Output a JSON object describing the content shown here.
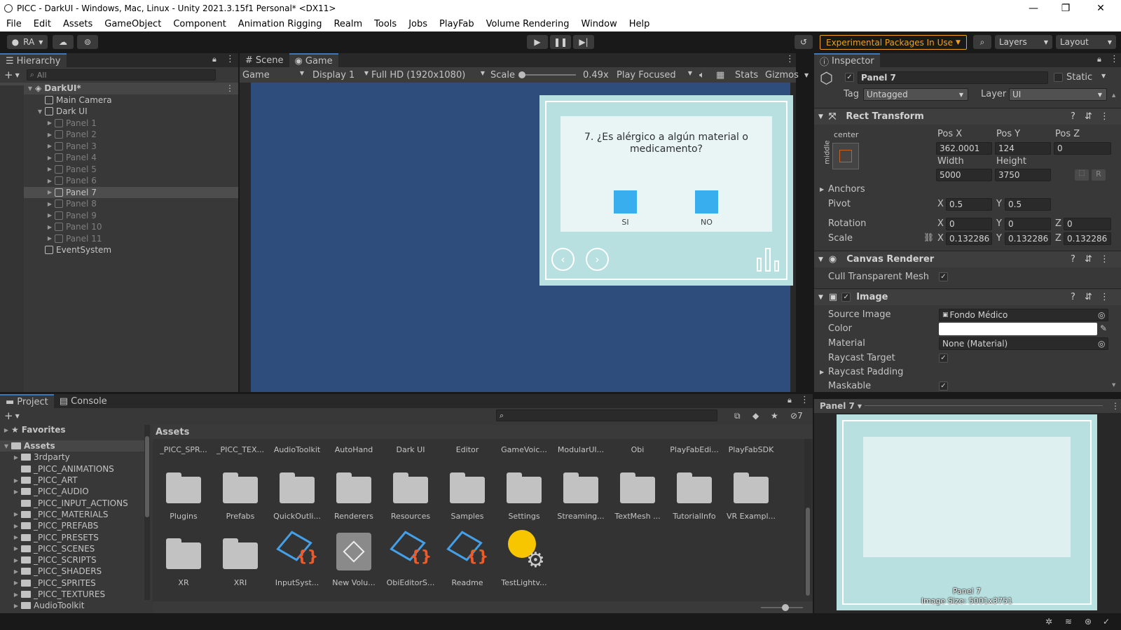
{
  "window": {
    "title": "PICC - DarkUI - Windows, Mac, Linux - Unity 2021.3.15f1 Personal* <DX11>",
    "minimize": "—",
    "maximize": "❐",
    "close": "✕"
  },
  "menu": [
    "File",
    "Edit",
    "Assets",
    "GameObject",
    "Component",
    "Animation Rigging",
    "Realm",
    "Tools",
    "Jobs",
    "PlayFab",
    "Volume Rendering",
    "Window",
    "Help"
  ],
  "toolbar": {
    "account": "RA",
    "experimental": "Experimental Packages In Use",
    "layers": "Layers",
    "layout": "Layout"
  },
  "hierarchy": {
    "tab": "Hierarchy",
    "search_placeholder": "All",
    "scene": "DarkUI*",
    "items": [
      {
        "label": "Main Camera",
        "dim": false,
        "indent": 1,
        "arrow": ""
      },
      {
        "label": "Dark UI",
        "dim": false,
        "indent": 1,
        "arrow": "▼"
      },
      {
        "label": "Panel 1",
        "dim": true,
        "indent": 2,
        "arrow": "▶"
      },
      {
        "label": "Panel 2",
        "dim": true,
        "indent": 2,
        "arrow": "▶"
      },
      {
        "label": "Panel 3",
        "dim": true,
        "indent": 2,
        "arrow": "▶"
      },
      {
        "label": "Panel 4",
        "dim": true,
        "indent": 2,
        "arrow": "▶"
      },
      {
        "label": "Panel 5",
        "dim": true,
        "indent": 2,
        "arrow": "▶"
      },
      {
        "label": "Panel 6",
        "dim": true,
        "indent": 2,
        "arrow": "▶"
      },
      {
        "label": "Panel 7",
        "dim": false,
        "indent": 2,
        "arrow": "▶",
        "selected": true
      },
      {
        "label": "Panel 8",
        "dim": true,
        "indent": 2,
        "arrow": "▶"
      },
      {
        "label": "Panel 9",
        "dim": true,
        "indent": 2,
        "arrow": "▶"
      },
      {
        "label": "Panel 10",
        "dim": true,
        "indent": 2,
        "arrow": "▶"
      },
      {
        "label": "Panel 11",
        "dim": true,
        "indent": 2,
        "arrow": "▶"
      },
      {
        "label": "EventSystem",
        "dim": false,
        "indent": 1,
        "arrow": ""
      }
    ]
  },
  "game": {
    "tabs": [
      "Scene",
      "Game"
    ],
    "display_mode": "Game",
    "display": "Display 1",
    "resolution": "Full HD (1920x1080)",
    "scale_label": "Scale",
    "scale_value": "0.49x",
    "play_mode": "Play Focused",
    "stats": "Stats",
    "gizmos": "Gizmos",
    "question": "7. ¿Es alérgico a algún material o medicamento?",
    "option_yes": "SI",
    "option_no": "NO"
  },
  "inspector": {
    "tab": "Inspector",
    "object_name": "Panel 7",
    "static": "Static",
    "tag_label": "Tag",
    "tag": "Untagged",
    "layer_label": "Layer",
    "layer": "UI",
    "rect_transform": "Rect Transform",
    "anchor_h": "center",
    "anchor_v": "middle",
    "pos_x_label": "Pos X",
    "pos_y_label": "Pos Y",
    "pos_z_label": "Pos Z",
    "pos_x": "362.0001",
    "pos_y": "124",
    "pos_z": "0",
    "width_label": "Width",
    "height_label": "Height",
    "width": "5000",
    "height": "3750",
    "r_button": "R",
    "anchors": "Anchors",
    "pivot": "Pivot",
    "pivot_x": "0.5",
    "pivot_y": "0.5",
    "rotation": "Rotation",
    "rot_x": "0",
    "rot_y": "0",
    "rot_z": "0",
    "scale": "Scale",
    "scale_x": "0.132286",
    "scale_y": "0.132286",
    "scale_z": "0.132286",
    "canvas_renderer": "Canvas Renderer",
    "cull": "Cull Transparent Mesh",
    "image": "Image",
    "source_image_label": "Source Image",
    "source_image": "Fondo Médico",
    "color_label": "Color",
    "material_label": "Material",
    "material": "None (Material)",
    "raycast_target": "Raycast Target",
    "raycast_padding": "Raycast Padding",
    "maskable": "Maskable",
    "axis_x": "X",
    "axis_y": "Y",
    "axis_z": "Z",
    "preview_title": "Panel 7",
    "preview_name": "Panel 7",
    "preview_size": "Image Size: 5001x3751"
  },
  "project": {
    "tabs": [
      "Project",
      "Console"
    ],
    "favorites": "Favorites",
    "assets_root": "Assets",
    "breadcrumb": "Assets",
    "hidden_count": "7",
    "tree": [
      "3rdparty",
      "_PICC_ANIMATIONS",
      "_PICC_ART",
      "_PICC_AUDIO",
      "_PICC_INPUT_ACTIONS",
      "_PICC_MATERIALS",
      "_PICC_PREFABS",
      "_PICC_PRESETS",
      "_PICC_SCENES",
      "_PICC_SCRIPTS",
      "_PICC_SHADERS",
      "_PICC_SPRITES",
      "_PICC_TEXTURES",
      "AudioToolkit"
    ],
    "top_row": [
      "_PICC_SPR...",
      "_PICC_TEX...",
      "AudioToolkit",
      "AutoHand",
      "Dark UI",
      "Editor",
      "GameVoic...",
      "ModularUI...",
      "Obi",
      "PlayFabEdi...",
      "PlayFabSDK"
    ],
    "row2": [
      "Plugins",
      "Prefabs",
      "QuickOutli...",
      "Renderers",
      "Resources",
      "Samples",
      "Settings",
      "Streaming...",
      "TextMesh ...",
      "TutorialInfo",
      "VR Exampl..."
    ],
    "row3": [
      {
        "label": "XR",
        "kind": "folder"
      },
      {
        "label": "XRI",
        "kind": "folder"
      },
      {
        "label": "InputSyst...",
        "kind": "script"
      },
      {
        "label": "New Volu...",
        "kind": "prefab"
      },
      {
        "label": "ObiEditorS...",
        "kind": "script"
      },
      {
        "label": "Readme",
        "kind": "script"
      },
      {
        "label": "TestLightv...",
        "kind": "lighting"
      }
    ]
  },
  "colors": {
    "accent": "#3a79bb",
    "game_bg": "#2e4d7c",
    "button_blue": "#2eaaf0",
    "experimental": "#f0a020"
  }
}
